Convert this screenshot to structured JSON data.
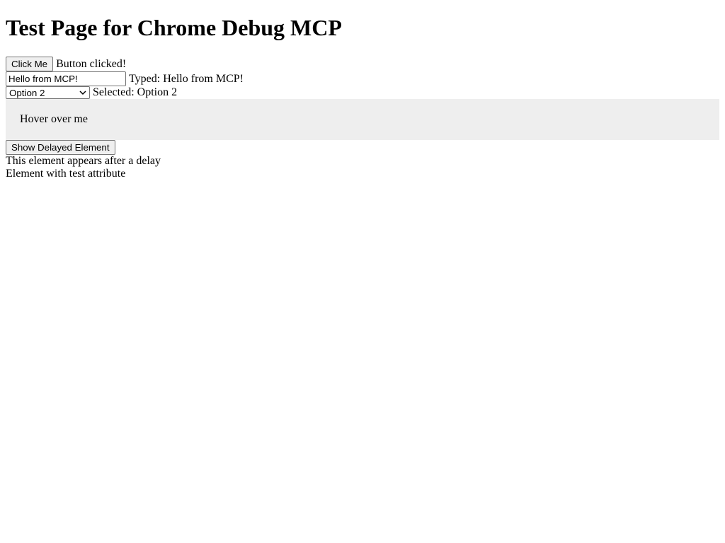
{
  "page": {
    "title": "Test Page for Chrome Debug MCP"
  },
  "click_section": {
    "button_label": "Click Me",
    "result_text": "Button clicked!"
  },
  "type_section": {
    "input_value": "Hello from MCP!",
    "result_text": "Typed: Hello from MCP!"
  },
  "select_section": {
    "selected_value": "Option 2",
    "result_text": "Selected: Option 2",
    "icon": "chevron-down-icon"
  },
  "hover_section": {
    "text": "Hover over me",
    "background_color": "#eeeeee"
  },
  "delayed_section": {
    "button_label": "Show Delayed Element",
    "delayed_text": "This element appears after a delay",
    "test_attr_text": "Element with test attribute"
  }
}
